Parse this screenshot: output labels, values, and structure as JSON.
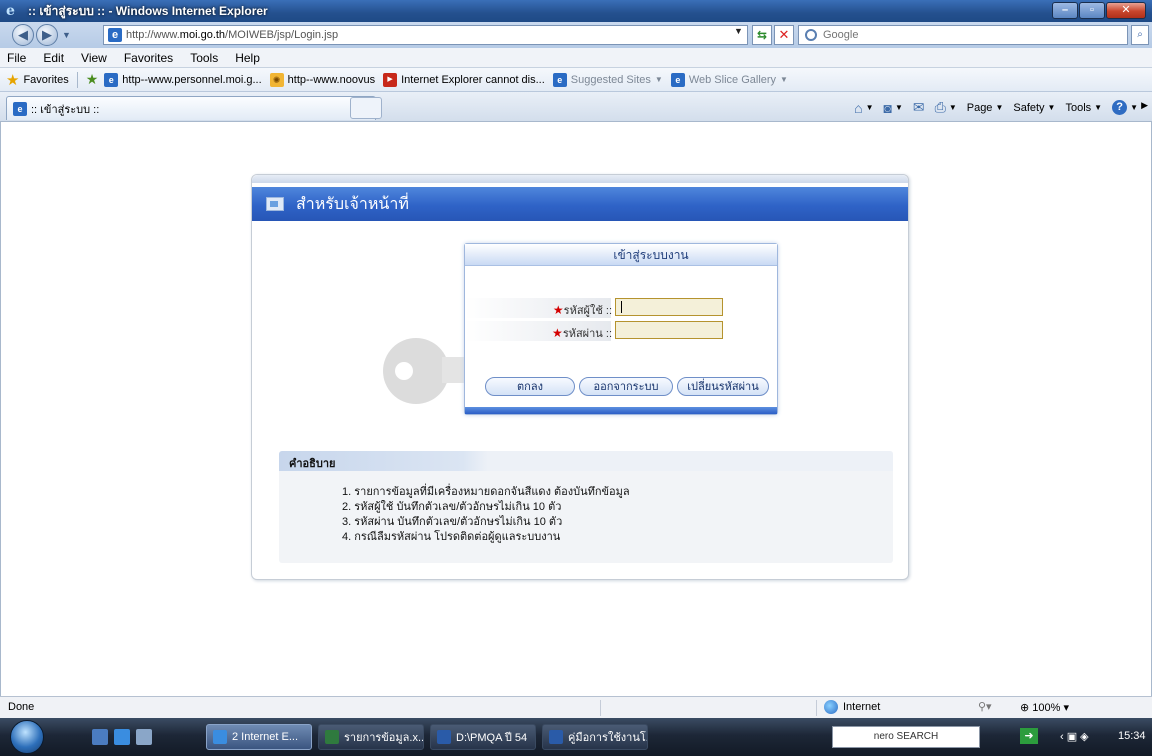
{
  "window": {
    "title": ":: เข้าสู่ระบบ :: - Windows Internet Explorer"
  },
  "addressbar": {
    "url": "http://www.moi.go.th/MOIWEB/jsp/Login.jsp",
    "url_plain_prefix": "http://www.",
    "url_bold": "moi.go.th",
    "url_suffix": "/MOIWEB/jsp/Login.jsp",
    "search_placeholder": "Google"
  },
  "menu": [
    "File",
    "Edit",
    "View",
    "Favorites",
    "Tools",
    "Help"
  ],
  "favorites": {
    "label": "Favorites",
    "links": [
      {
        "label": "http--www.personnel.moi.g...",
        "icon": "ie-page-icon"
      },
      {
        "label": "http--www.noovus",
        "icon": "sun-icon"
      },
      {
        "label": "Internet Explorer cannot dis...",
        "icon": "youtube-icon"
      },
      {
        "label": "Suggested Sites",
        "icon": "ie-logo-icon",
        "dropdown": true
      },
      {
        "label": "Web Slice Gallery",
        "icon": "ie-page-icon",
        "dropdown": true
      }
    ]
  },
  "tab": {
    "label": ":: เข้าสู่ระบบ ::"
  },
  "commandbar": {
    "page": "Page",
    "safety": "Safety",
    "tools": "Tools"
  },
  "page": {
    "header_title": "สำหรับเจ้าหน้าที่",
    "login_title": "เข้าสู่ระบบงาน",
    "username_label": "รหัสผู้ใช้ ::",
    "password_label": "รหัสผ่าน ::",
    "username_value": "",
    "password_value": "",
    "buttons": {
      "ok": "ตกลง",
      "exit": "ออกจากระบบ",
      "change_password": "เปลี่ยนรหัสผ่าน"
    },
    "description_title": "คำอธิบาย",
    "description_items": [
      "1. รายการข้อมูลที่มีเครื่องหมายดอกจันสีแดง ต้องบันทึกข้อมูล",
      "2. รหัสผู้ใช้ บันทึกตัวเลข/ตัวอักษรไม่เกิน 10 ตัว",
      "3. รหัสผ่าน บันทึกตัวเลข/ตัวอักษรไม่เกิน 10 ตัว",
      "4. กรณีลืมรหัสผ่าน โปรดติดต่อผู้ดูแลระบบงาน"
    ]
  },
  "status": {
    "text": "Done",
    "zone": "Internet",
    "zoom": "100%"
  },
  "taskbar": {
    "buttons": [
      {
        "label": "2 Internet E...",
        "active": true
      },
      {
        "label": "รายการข้อมูล.x..."
      },
      {
        "label": "D:\\PMQA ปี 54"
      },
      {
        "label": "คู่มือการใช้งานโ..."
      }
    ],
    "nero_label": "nero SEARCH",
    "clock": "15:34"
  },
  "colors": {
    "header_blue": "#2f63c7",
    "required_star": "#d40000",
    "input_bg": "#f4f0d9"
  }
}
